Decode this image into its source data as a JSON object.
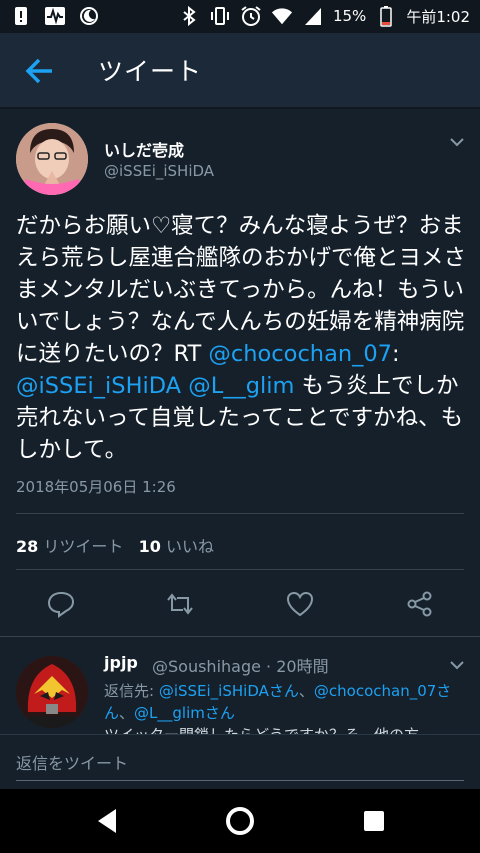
{
  "status_bar": {
    "battery_percent": "15%",
    "time": "午前1:02",
    "icons": [
      "alert-icon",
      "activity-icon",
      "moon-icon",
      "bluetooth-icon",
      "vibrate-icon",
      "alarm-icon",
      "wifi-icon",
      "signal-icon",
      "battery-icon"
    ]
  },
  "appbar": {
    "title": "ツイート"
  },
  "tweet": {
    "display_name": "いしだ壱成",
    "handle": "@iSSEi_iSHiDA",
    "text_plain": "だからお願い♡寝て？みんな寝ようぜ？おまえら荒らし屋連合艦隊のおかげで俺とヨメさまメンタルだいぶきてっから。んね！もういいでしょう？なんで人んちの妊婦を精神病院に送りたいの？RT ",
    "mention1": "@chocochan_07",
    "colon": ": ",
    "mention2": "@iSSEi_iSHiDA",
    "space": " ",
    "mention3": "@L__glim",
    "text_end": " もう炎上でしか売れないって自覚したってことですかね、もしかして。",
    "date": "2018年05月06日 1:26",
    "retweet_count": "28",
    "retweet_label": "リツイート",
    "like_count": "10",
    "like_label": "いいね"
  },
  "reply": {
    "display_name": "jpjp",
    "meta": "@Soushihage · 20時間",
    "to_prefix": "返信先: ",
    "to_m1": "@iSSEi_iSHiDAさん",
    "sep1": "、",
    "to_m2": "@chocochan_07さん",
    "sep2": "、",
    "to_m3": "@L__glimさん",
    "text": "ツイッター閉鎖したらどうですか？そ…他の方"
  },
  "reply_input": {
    "placeholder": "返信をツイート"
  },
  "colors": {
    "background": "#15202b",
    "accent": "#1da1f2",
    "secondary_text": "#8899a6"
  }
}
